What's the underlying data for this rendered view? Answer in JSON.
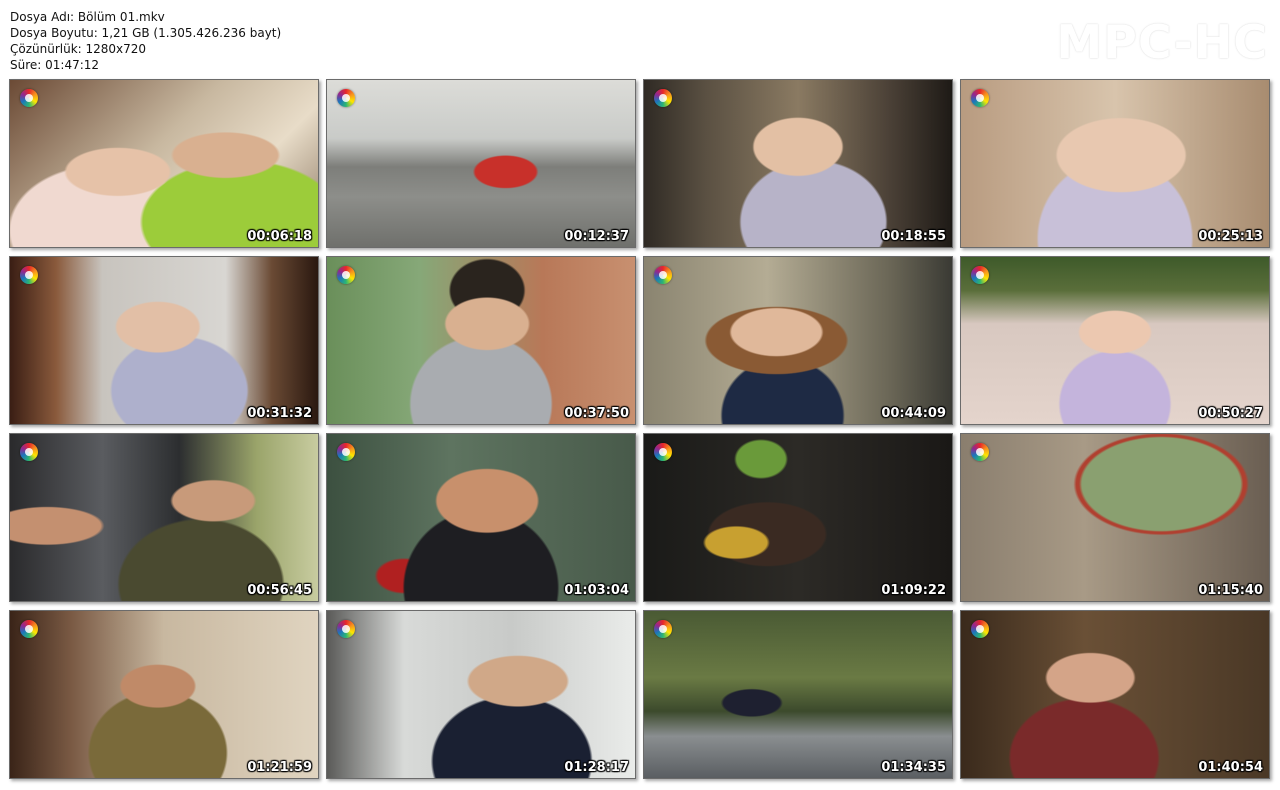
{
  "file_info": {
    "name": "Dosya Adı: Bölüm 01.mkv",
    "size": "Dosya Boyutu: 1,21 GB (1.305.426.236 bayt)",
    "resolution": "Çözünürlük: 1280x720",
    "duration": "Süre: 01:47:12"
  },
  "logo": "MPC-HC",
  "thumbnails": [
    {
      "time": "00:06:18"
    },
    {
      "time": "00:12:37"
    },
    {
      "time": "00:18:55"
    },
    {
      "time": "00:25:13"
    },
    {
      "time": "00:31:32"
    },
    {
      "time": "00:37:50"
    },
    {
      "time": "00:44:09"
    },
    {
      "time": "00:50:27"
    },
    {
      "time": "00:56:45"
    },
    {
      "time": "01:03:04"
    },
    {
      "time": "01:09:22"
    },
    {
      "time": "01:15:40"
    },
    {
      "time": "01:21:59"
    },
    {
      "time": "01:28:17"
    },
    {
      "time": "01:34:35"
    },
    {
      "time": "01:40:54"
    }
  ]
}
